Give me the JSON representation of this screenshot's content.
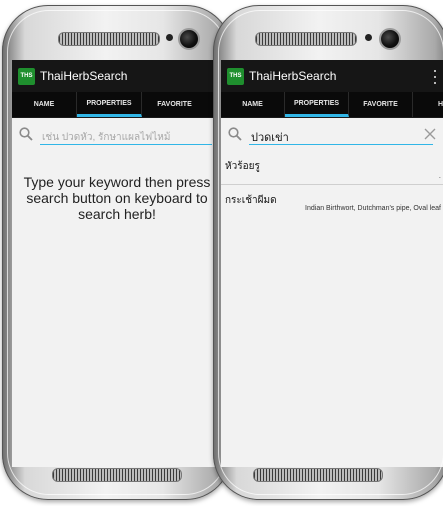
{
  "app": {
    "icon_text": "THS",
    "title": "ThaiHerbSearch"
  },
  "tabs_left": [
    {
      "label": "NAME"
    },
    {
      "label": "PROPERTIES"
    },
    {
      "label": "FAVORITE"
    }
  ],
  "tabs_right": [
    {
      "label": "NAME"
    },
    {
      "label": "PROPERTIES"
    },
    {
      "label": "FAVORITE"
    },
    {
      "label": "HEF"
    }
  ],
  "left_screen": {
    "search_placeholder": "เช่น ปวดหัว, รักษาแผลไฟไหม้",
    "hint": "Type your keyword then press search button on keyboard to search herb!"
  },
  "right_screen": {
    "search_value": "ปวดเข่า",
    "results": [
      {
        "thai": "หัวร้อยรู",
        "english": "",
        "more": "."
      },
      {
        "thai": "กระเช้าผีมด",
        "english": "Indian Birthwort, Dutchman's pipe, Oval leaf"
      }
    ]
  },
  "colors": {
    "accent": "#31b6e7",
    "app_icon": "#1f8f2e",
    "actionbar": "#161616"
  }
}
